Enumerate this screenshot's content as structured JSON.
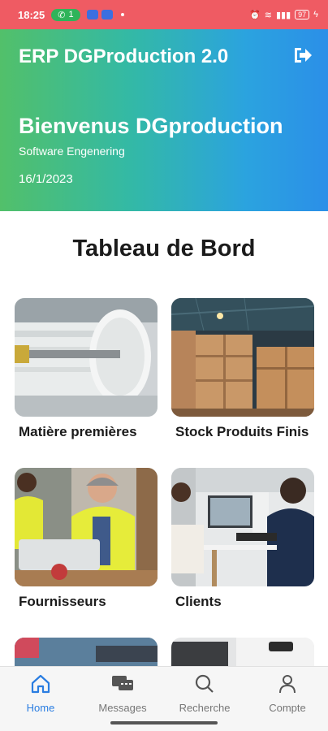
{
  "status_bar": {
    "time": "18:25",
    "notif_count": "1",
    "battery": "97"
  },
  "header": {
    "app_title": "ERP DGProduction 2.0",
    "welcome": "Bienvenus DGproduction",
    "subtitle": "Software Engenering",
    "date": "16/1/2023",
    "logout_icon": "logout-icon"
  },
  "dashboard": {
    "title": "Tableau de Bord",
    "cards": [
      {
        "label": "Matière premières",
        "icon": "paper-roll-photo"
      },
      {
        "label": "Stock Produits Finis",
        "icon": "warehouse-boxes-photo"
      },
      {
        "label": "Fournisseurs",
        "icon": "supplier-worker-photo"
      },
      {
        "label": "Clients",
        "icon": "office-client-photo"
      },
      {
        "label": "",
        "icon": "cart-photo"
      },
      {
        "label": "",
        "icon": "laptop-desk-photo"
      }
    ]
  },
  "nav": {
    "items": [
      {
        "label": "Home",
        "icon": "home-icon"
      },
      {
        "label": "Messages",
        "icon": "chat-icon"
      },
      {
        "label": "Recherche",
        "icon": "search-icon"
      },
      {
        "label": "Compte",
        "icon": "person-icon"
      }
    ],
    "active_color": "#2a7de1"
  }
}
